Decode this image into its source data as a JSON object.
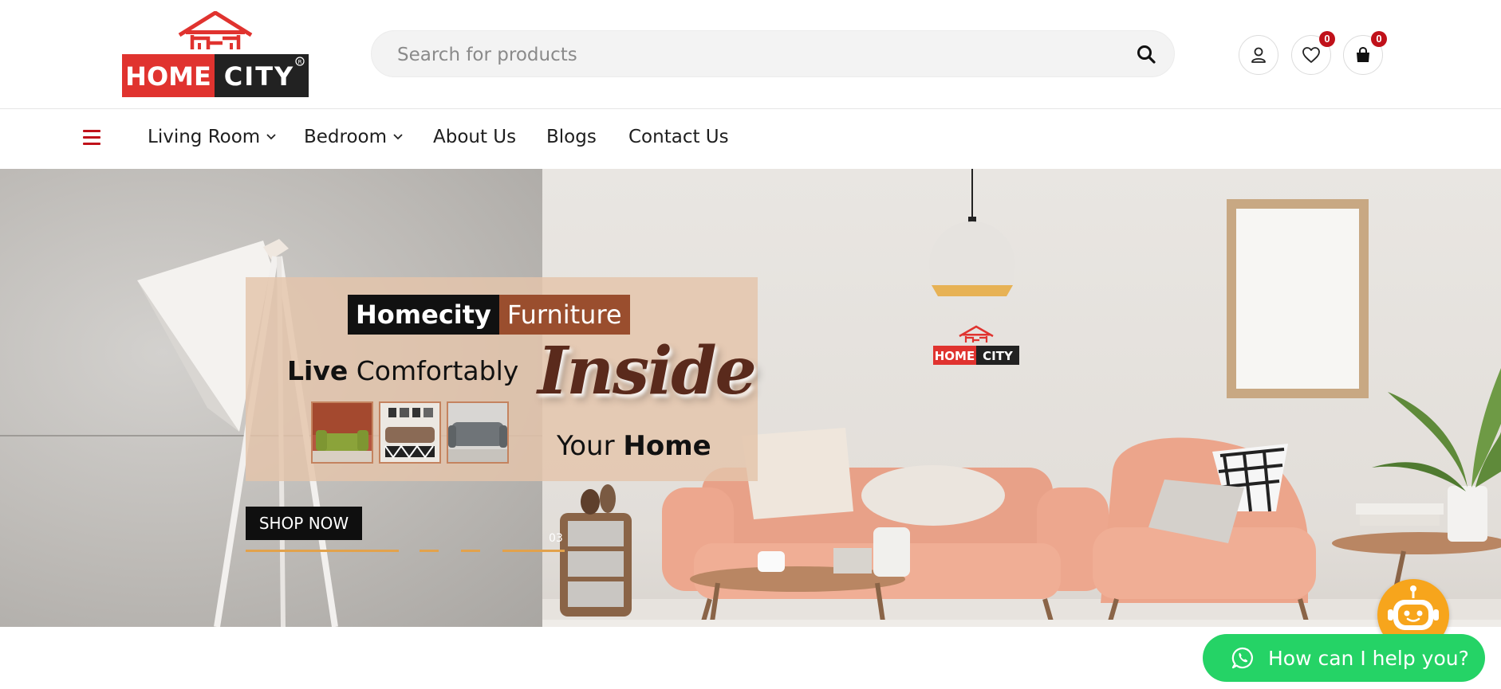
{
  "brand": {
    "logo_word_1": "HOME",
    "logo_word_2": "CITY",
    "accent": "#c0111a"
  },
  "search": {
    "placeholder": "Search for products",
    "icon": "search-icon"
  },
  "header_icons": {
    "account_icon": "user-icon",
    "wishlist_count": "0",
    "cart_count": "0"
  },
  "nav": {
    "menu_icon": "hamburger-icon",
    "items": [
      {
        "label": "Living Room",
        "has_dropdown": true
      },
      {
        "label": "Bedroom",
        "has_dropdown": true
      },
      {
        "label": "About Us",
        "has_dropdown": false
      },
      {
        "label": "Blogs",
        "has_dropdown": false
      },
      {
        "label": "Contact Us",
        "has_dropdown": false
      }
    ]
  },
  "hero": {
    "brand_bold": "Homecity",
    "brand_rest": "Furniture",
    "line_bold": "Live",
    "line_rest": "Comfortably",
    "script_word": "Inside",
    "tail_rest": "Your",
    "tail_bold": "Home",
    "cta": "SHOP NOW",
    "slide_number": "03"
  },
  "floating": {
    "whatsapp_label": "How can I help you?",
    "whatsapp_color": "#25d366",
    "chatbot_color": "#f7a51c"
  }
}
